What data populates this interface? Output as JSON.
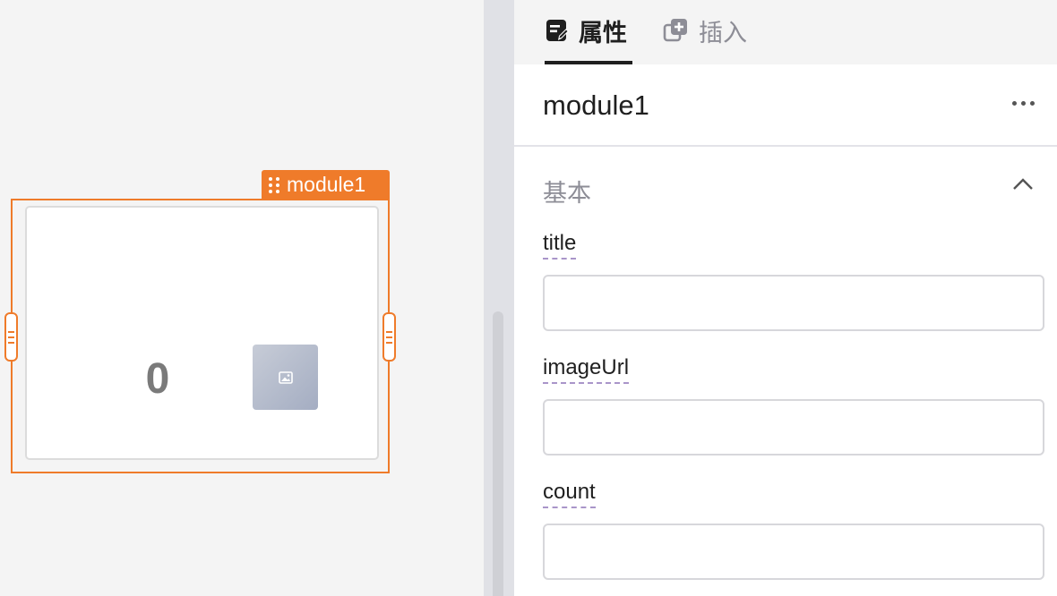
{
  "canvas": {
    "module_tag": "module1",
    "count_value": "0",
    "accent_color": "#ef7b2a"
  },
  "panel": {
    "tabs": [
      {
        "label": "属性",
        "icon": "edit-note-icon",
        "active": true
      },
      {
        "label": "插入",
        "icon": "add-copy-icon",
        "active": false
      }
    ],
    "title": "module1",
    "more_icon": "more-horizontal-icon",
    "section": {
      "title": "基本",
      "collapse_icon": "chevron-up-icon",
      "fields": [
        {
          "label": "title",
          "value": "",
          "placeholder": ""
        },
        {
          "label": "imageUrl",
          "value": "",
          "placeholder": ""
        },
        {
          "label": "count",
          "value": "",
          "placeholder": ""
        }
      ]
    }
  }
}
